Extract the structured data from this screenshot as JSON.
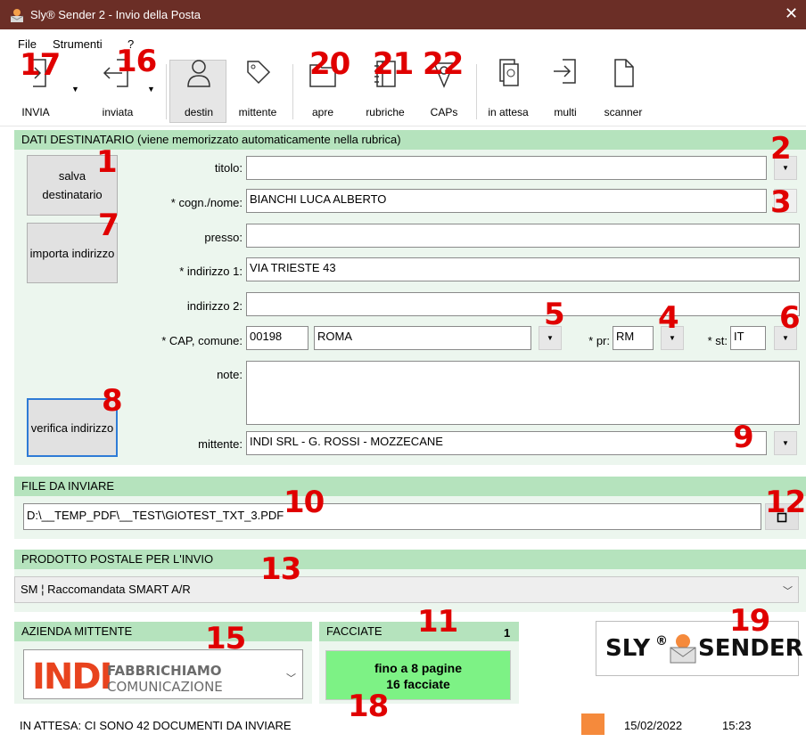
{
  "window": {
    "title": "Sly® Sender 2 - Invio della Posta",
    "close": "✕"
  },
  "menu": [
    "File",
    "Strumenti",
    "?"
  ],
  "toolbar": {
    "invia": "INVIA",
    "inviata": "inviata",
    "destin": "destin",
    "mittente": "mittente",
    "apre": "apre",
    "rubriche": "rubriche",
    "caps": "CAPs",
    "in_attesa": "in attesa",
    "multi": "multi",
    "scanner": "scanner"
  },
  "dest": {
    "header": "DATI DESTINATARIO (viene memorizzato automaticamente nella rubrica)",
    "salva": "salva destinatario",
    "importa": "importa indirizzo",
    "verifica": "verifica indirizzo",
    "l_titolo": "titolo:",
    "v_titolo": "",
    "l_cognome": "* cogn./nome:",
    "v_cognome": "BIANCHI LUCA ALBERTO",
    "l_presso": "presso:",
    "v_presso": "",
    "l_ind1": "* indirizzo 1:",
    "v_ind1": "VIA TRIESTE 43",
    "l_ind2": "indirizzo 2:",
    "v_ind2": "",
    "l_cap": "* CAP, comune:",
    "v_cap": "00198",
    "v_comune": "ROMA",
    "l_pr": "* pr:",
    "v_pr": "RM",
    "l_st": "* st:",
    "v_st": "IT",
    "l_note": "note:",
    "v_note": "",
    "l_mittente": "mittente:",
    "v_mittente": "INDI SRL - G. ROSSI - MOZZECANE"
  },
  "file": {
    "header": "FILE DA INVIARE",
    "path": "D:\\__TEMP_PDF\\__TEST\\GIOTEST_TXT_3.PDF"
  },
  "prodotto": {
    "header": "PRODOTTO POSTALE PER L'INVIO",
    "value": "SM ¦ Raccomandata SMART A/R"
  },
  "azienda": {
    "header": "AZIENDA MITTENTE",
    "logo_main": "INDI",
    "logo_top": "FABBRICHIAMO",
    "logo_bottom": "COMUNICAZIONE"
  },
  "facciate": {
    "header": "FACCIATE",
    "count": "1",
    "line1": "fino a 8 pagine",
    "line2": "16 facciate"
  },
  "brand": {
    "left": "SLY",
    "reg": "®",
    "right": "SENDER"
  },
  "status": {
    "text": "IN ATTESA: CI SONO 42 DOCUMENTI DA INVIARE",
    "date": "15/02/2022",
    "time": "15:23",
    "square_color": "#f58a3c"
  },
  "callouts": {
    "n1": "1",
    "n2": "2",
    "n3": "3",
    "n4": "4",
    "n5": "5",
    "n6": "6",
    "n7": "7",
    "n8": "8",
    "n9": "9",
    "n10": "10",
    "n11": "11",
    "n12": "12",
    "n13": "13",
    "n15": "15",
    "n16": "16",
    "n17": "17",
    "n18": "18",
    "n19": "19",
    "n20": "20",
    "n21": "21",
    "n22": "22"
  }
}
